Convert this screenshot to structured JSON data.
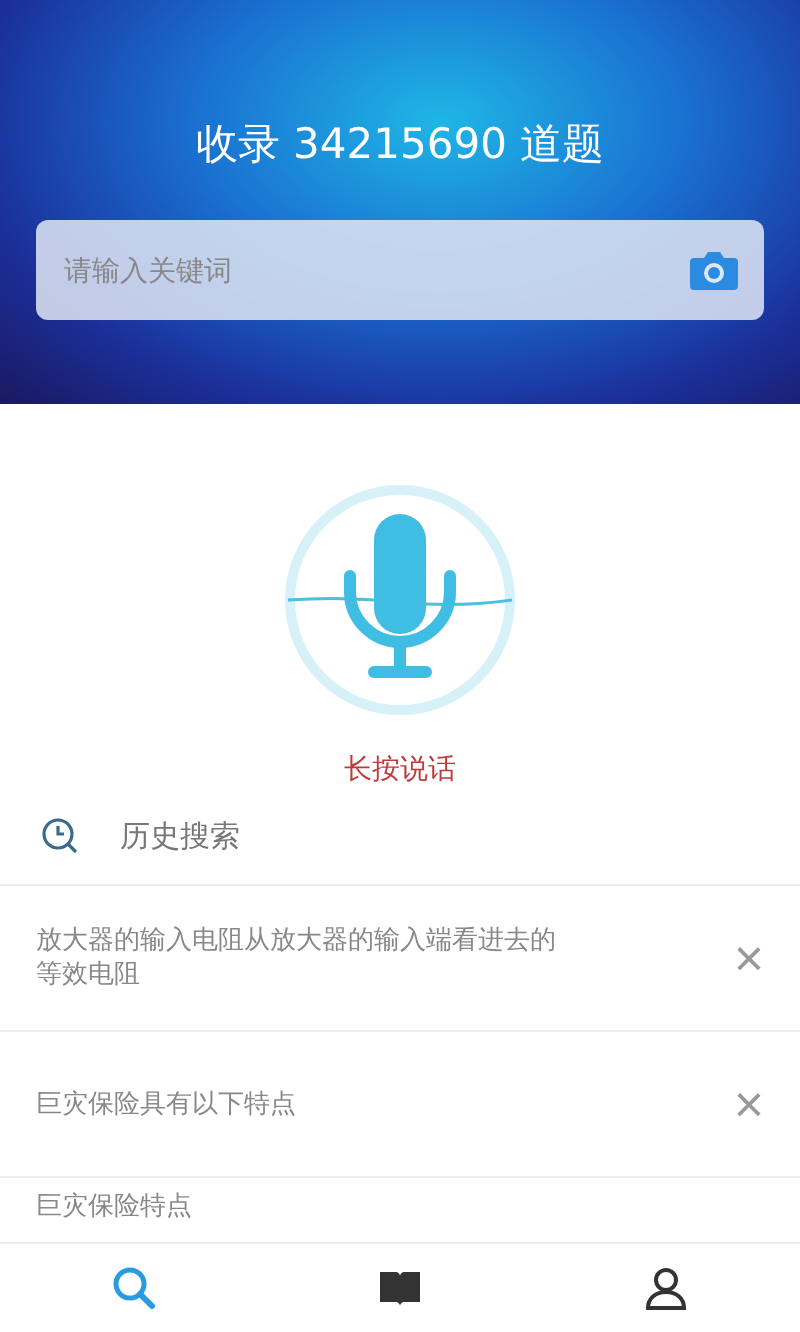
{
  "header": {
    "title": "收录 34215690 道题",
    "search": {
      "placeholder": "请输入关键词"
    }
  },
  "voice": {
    "hint": "长按说话"
  },
  "history": {
    "title": "历史搜索",
    "items": [
      {
        "text": "放大器的输入电阻从放大器的输入端看进去的等效电阻",
        "close": "×"
      },
      {
        "text": "巨灾保险具有以下特点",
        "close": "×"
      },
      {
        "text": "巨灾保险特点"
      }
    ]
  },
  "tabs": [
    {
      "kind": "search",
      "selected": true
    },
    {
      "kind": "book",
      "selected": false
    },
    {
      "kind": "profile",
      "selected": false
    }
  ]
}
